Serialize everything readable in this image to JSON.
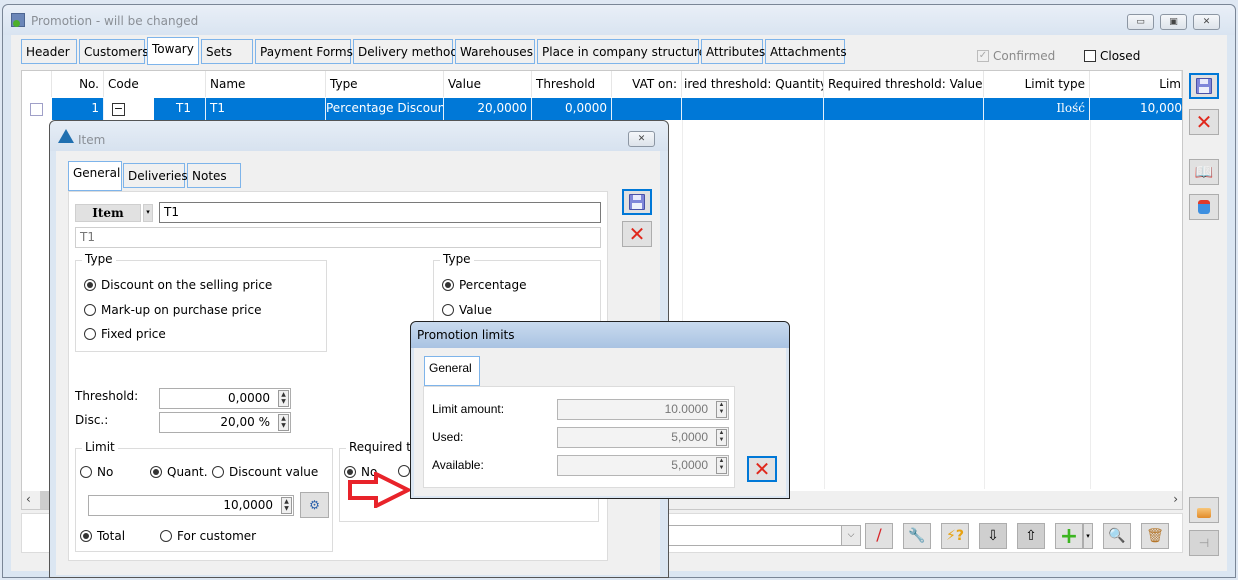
{
  "window": {
    "title": "Promotion - will be changed",
    "controls": {
      "minimize": "▭",
      "maximize": "▣",
      "close": "✕"
    }
  },
  "tabs": [
    {
      "label": "Header"
    },
    {
      "label": "Customers"
    },
    {
      "label": "Towary",
      "active": true
    },
    {
      "label": "Sets"
    },
    {
      "label": "Payment Forms"
    },
    {
      "label": "Delivery method"
    },
    {
      "label": "Warehouses"
    },
    {
      "label": "Place in company structure"
    },
    {
      "label": "Attributes"
    },
    {
      "label": "Attachments"
    }
  ],
  "flags": {
    "confirmed": {
      "label": "Confirmed",
      "checked": true,
      "disabled": true
    },
    "closed": {
      "label": "Closed",
      "checked": false
    }
  },
  "grid": {
    "columns": [
      "No.",
      "Code",
      "Name",
      "Type",
      "Value",
      "Threshold",
      "VAT on:",
      "ired threshold: Quantity",
      "Required threshold: Value",
      "Limit type",
      "Lim"
    ],
    "rows": [
      {
        "no": "1",
        "code_toggle": "−",
        "code": "T1",
        "name": "T1",
        "type": "Percentage Discount",
        "value": "20,0000",
        "threshold": "0,0000",
        "vat_on": "",
        "req_qty": "",
        "req_value": "",
        "limit_type": "Ilość",
        "limit": "10,000"
      }
    ]
  },
  "side_buttons": [
    "save-icon",
    "cancel-icon",
    "book-icon",
    "import-icon"
  ],
  "bottom_toolbar": {
    "filter_value": "",
    "buttons": [
      "clear-filter-icon",
      "settings-wrench-icon",
      "help-lightning-icon",
      "download-icon",
      "upload-icon",
      "add-icon",
      "search-icon",
      "trash-icon"
    ]
  },
  "item_dialog": {
    "title": "Item",
    "tabs": [
      {
        "label": "General",
        "active": true
      },
      {
        "label": "Deliveries"
      },
      {
        "label": "Notes"
      }
    ],
    "item_button": "Item",
    "item_code": "T1",
    "item_name": "T1",
    "type_group": {
      "label": "Type",
      "options": [
        {
          "label": "Discount on the selling price",
          "selected": true
        },
        {
          "label": "Mark-up on purchase price",
          "selected": false
        },
        {
          "label": "Fixed price",
          "selected": false
        }
      ]
    },
    "type2_group": {
      "label": "Type",
      "options": [
        {
          "label": "Percentage",
          "selected": true
        },
        {
          "label": "Value",
          "selected": false
        }
      ]
    },
    "threshold_label": "Threshold:",
    "threshold_value": "0,0000",
    "disc_label": "Disc.:",
    "disc_value": "20,00 %",
    "limit_group": {
      "label": "Limit",
      "options": [
        {
          "label": "No",
          "selected": false
        },
        {
          "label": "Quant.",
          "selected": true
        },
        {
          "label": "Discount value",
          "selected": false
        }
      ],
      "value": "10,0000",
      "scope_options": [
        {
          "label": "Total",
          "selected": true
        },
        {
          "label": "For customer",
          "selected": false
        }
      ]
    },
    "required_group": {
      "label": "Required tr",
      "options": [
        {
          "label": "No",
          "selected": true
        }
      ]
    }
  },
  "limits_dialog": {
    "title": "Promotion limits",
    "tab": "General",
    "fields": [
      {
        "label": "Limit amount:",
        "value": "10.0000"
      },
      {
        "label": "Used:",
        "value": "5,0000"
      },
      {
        "label": "Available:",
        "value": "5,0000"
      }
    ]
  },
  "annotation": {
    "arrow_color": "#e8232a"
  },
  "colors": {
    "selection": "#0078d7",
    "tab_border": "#7eb4ea",
    "cancel_red": "#e0281c"
  }
}
